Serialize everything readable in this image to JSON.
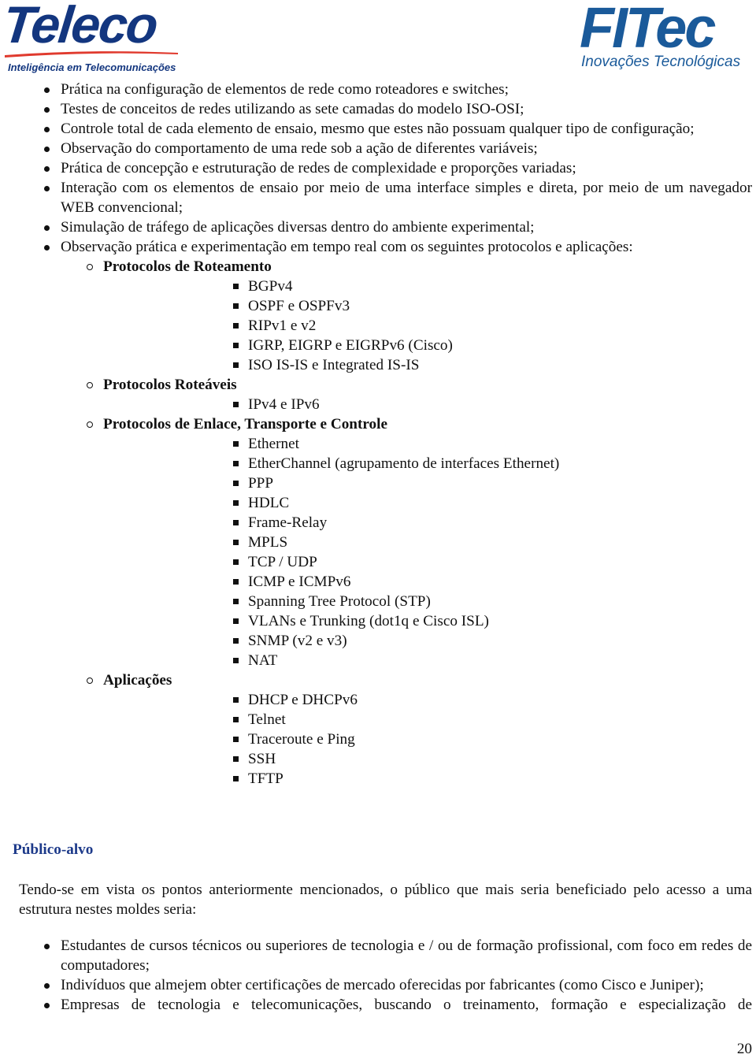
{
  "header": {
    "left_logo": {
      "name": "Teleco",
      "tagline": "Inteligência em Telecomunicações",
      "color": "#13367f",
      "swoosh_color": "#e03a2e"
    },
    "right_logo": {
      "name": "FITec",
      "tagline": "Inovações Tecnológicas",
      "color": "#1a5a9a"
    }
  },
  "benefits": [
    "Prática na configuração de elementos de rede como roteadores e switches;",
    "Testes de conceitos de redes utilizando as sete camadas do modelo ISO-OSI;",
    "Controle total de cada elemento de ensaio, mesmo que estes não possuam qualquer tipo de configuração;",
    "Observação do comportamento de uma rede sob a ação de diferentes variáveis;",
    "Prática de concepção e estruturação de redes de complexidade e proporções variadas;",
    "Interação com os elementos de ensaio por meio de uma interface simples e direta, por meio de um navegador WEB convencional;",
    "Simulação de tráfego de aplicações diversas dentro do ambiente experimental;",
    "Observação prática e experimentação em tempo real com os seguintes protocolos e aplicações:"
  ],
  "protocol_groups": [
    {
      "title": "Protocolos de Roteamento",
      "items": [
        "BGPv4",
        "OSPF e OSPFv3",
        "RIPv1 e v2",
        "IGRP, EIGRP e EIGRPv6 (Cisco)",
        "ISO IS-IS e Integrated IS-IS"
      ]
    },
    {
      "title": "Protocolos Roteáveis",
      "items": [
        "IPv4 e IPv6"
      ]
    },
    {
      "title": "Protocolos de Enlace, Transporte e Controle",
      "items": [
        "Ethernet",
        "EtherChannel (agrupamento de interfaces Ethernet)",
        "PPP",
        "HDLC",
        "Frame-Relay",
        "MPLS",
        "TCP / UDP",
        "ICMP e ICMPv6",
        "Spanning Tree Protocol (STP)",
        "VLANs e Trunking (dot1q e Cisco ISL)",
        "SNMP (v2 e v3)",
        "NAT"
      ]
    },
    {
      "title": "Aplicações",
      "items": [
        "DHCP e DHCPv6",
        "Telnet",
        "Traceroute e Ping",
        "SSH",
        "TFTP"
      ]
    }
  ],
  "audience_section": {
    "title": "Público-alvo",
    "title_color": "#1d3a8a",
    "intro": "Tendo-se em vista os pontos anteriormente mencionados, o público que mais seria beneficiado pelo acesso a uma estrutura nestes moldes seria:",
    "items": [
      "Estudantes de cursos técnicos ou superiores de tecnologia e / ou de formação profissional, com foco em redes de computadores;",
      "Indivíduos que almejem obter certificações de mercado oferecidas por fabricantes (como Cisco e Juniper);",
      "Empresas de tecnologia e telecomunicações, buscando o treinamento, formação e especialização de"
    ]
  },
  "page_number": "20"
}
